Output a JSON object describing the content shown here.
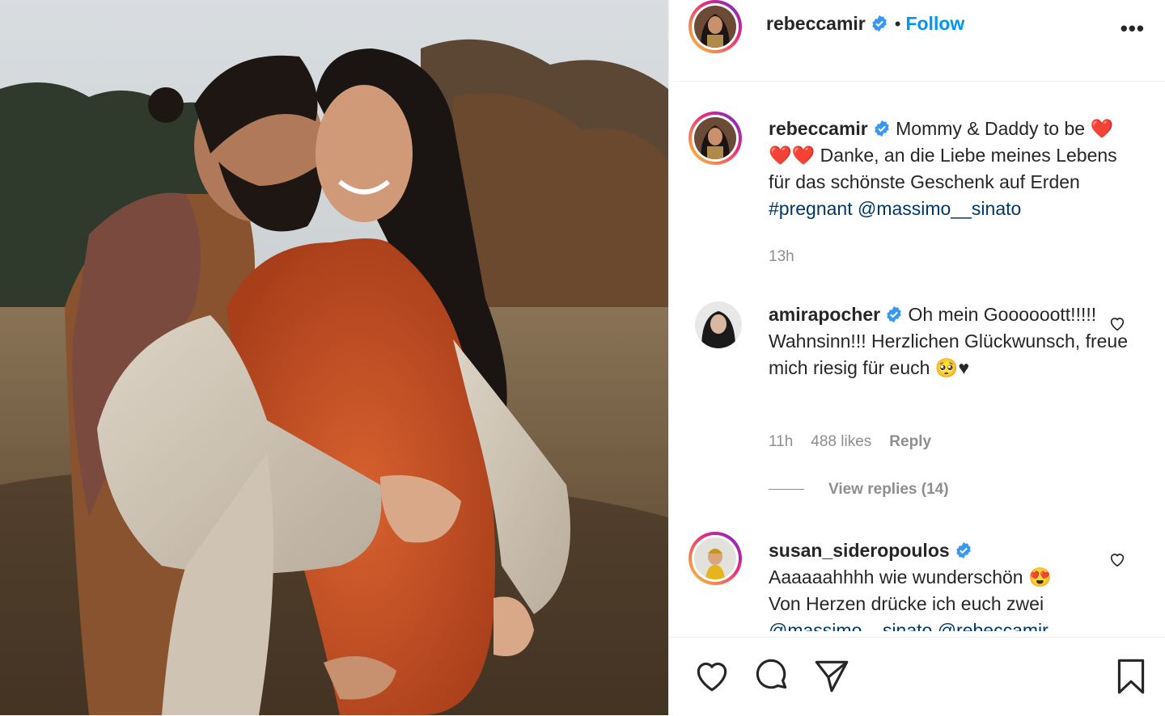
{
  "post": {
    "author": "rebeccamir",
    "follow_label": "Follow",
    "dot": "•",
    "more_label": "•••"
  },
  "caption": {
    "username": "rebeccamir",
    "text_before": "Mommy & Daddy to be",
    "text_after": "Danke, an die Liebe meines Lebens für das schönste Geschenk auf Erden",
    "hashtag": "#pregnant",
    "mention": "@massimo__sinato",
    "time": "13h"
  },
  "comments": [
    {
      "username": "amirapocher",
      "text": "Oh mein Goooooott!!!!! Wahnsinn!!! Herzlichen Glückwunsch, freue mich riesig für euch",
      "emoji": "🥺",
      "suffix": "♥",
      "time": "11h",
      "likes": "488 likes",
      "reply": "Reply",
      "view_replies": "View replies (14)"
    },
    {
      "username": "susan_sideropoulos",
      "text": "Aaaaaahhhh wie wunderschön",
      "emoji": "😍",
      "line2": "Von Herzen drücke ich euch zwei",
      "line3": "@massimo__sinato @rebeccamir"
    }
  ],
  "icons": {
    "like": "heart-icon",
    "comment": "comment-icon",
    "share": "share-icon",
    "save": "bookmark-icon",
    "verified": "verified-badge-icon"
  },
  "colors": {
    "link": "#0095f6",
    "tag": "#00376b",
    "muted": "#8e8e8e"
  }
}
